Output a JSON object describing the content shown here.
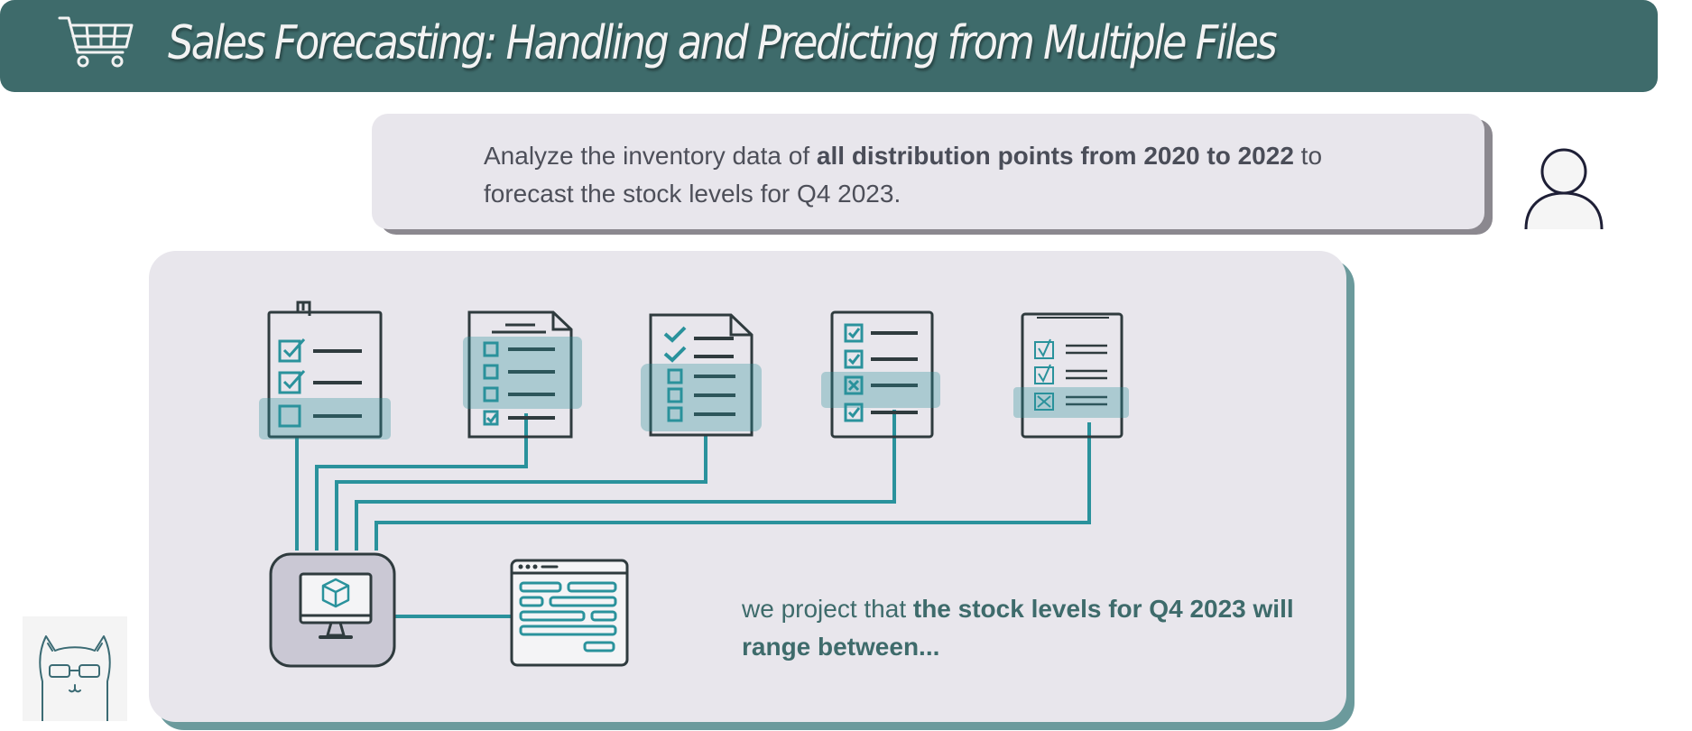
{
  "header": {
    "title": "Sales Forecasting: Handling and Predicting from Multiple Files",
    "icon": "shopping-cart-icon"
  },
  "user_message": {
    "prefix": "Analyze the inventory data of ",
    "highlight": "all distribution points from 2020 to 2022",
    "suffix": " to forecast the stock levels for Q4 2023."
  },
  "response": {
    "prefix": "we project that ",
    "highlight": "the stock levels for Q4 2023 will range between..."
  },
  "diagram": {
    "documents": [
      "checklist-document-icon",
      "document-icon",
      "checklist-document-icon",
      "checklist-document-icon",
      "clipboard-checklist-icon"
    ],
    "processor": "computer-monitor-icon",
    "output": "browser-window-icon"
  },
  "colors": {
    "banner": "#3e6b6b",
    "teal": "#2a929c",
    "panel": "#e8e6ec",
    "dark": "#2f3b3e"
  }
}
